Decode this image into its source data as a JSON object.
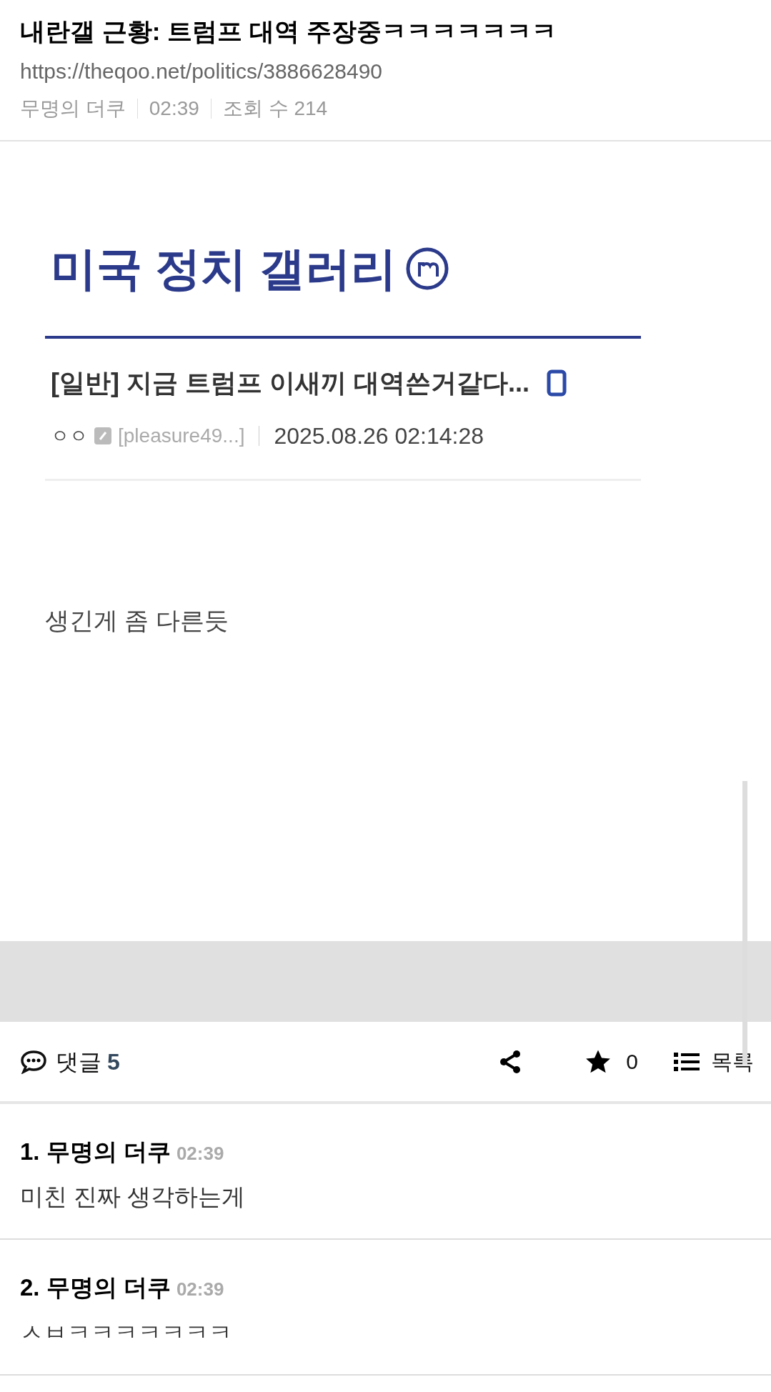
{
  "post": {
    "title": "내란갤 근황: 트럼프 대역 주장중ㅋㅋㅋㅋㅋㅋㅋ",
    "url": "https://theqoo.net/politics/3886628490",
    "author": "무명의 더쿠",
    "time": "02:39",
    "views": "조회 수 214"
  },
  "embedded_screenshot": {
    "gallery_title": "미국 정치 갤러리",
    "post_title": "[일반] 지금 트럼프 이새끼 대역쓴거같다...",
    "nickname": "ㅇㅇ",
    "user_id": "[pleasure49...]",
    "date": "2025.08.26 02:14:28"
  },
  "body_text": "생긴게 좀 다른듯",
  "toolbar": {
    "comments_label": "댓글",
    "comments_count": "5",
    "likes": "0",
    "list_label": "목록"
  },
  "comments": [
    {
      "number": "1.",
      "author": "무명의 더쿠",
      "time": "02:39",
      "text": "미친 진짜 생각하는게"
    },
    {
      "number": "2.",
      "author": "무명의 더쿠",
      "time": "02:39",
      "text": "ㅅㅂㅋㅋㅋㅋㅋㅋㅋ"
    }
  ]
}
